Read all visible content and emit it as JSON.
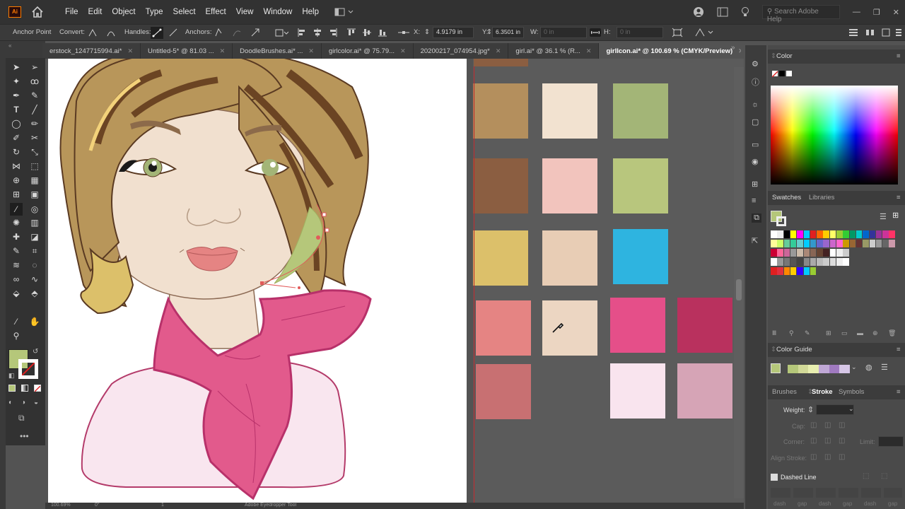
{
  "menubar": {
    "logo": "Ai",
    "items": [
      "File",
      "Edit",
      "Object",
      "Type",
      "Select",
      "Effect",
      "View",
      "Window",
      "Help"
    ],
    "search_placeholder": "Search Adobe Help"
  },
  "controlbar": {
    "anchor_point": "Anchor Point",
    "convert": "Convert:",
    "handles": "Handles:",
    "anchors": "Anchors:",
    "x_label": "X:",
    "x_value": "4.9179 in",
    "y_label": "Y:",
    "y_value": "6.3501 in",
    "w_label": "W:",
    "w_value": "0 in",
    "h_label": "H:",
    "h_value": "0 in"
  },
  "tabs": [
    {
      "label": "erstock_1247715994.ai*",
      "active": false
    },
    {
      "label": "Untitled-5* @ 81.03 ...",
      "active": false
    },
    {
      "label": "DoodleBrushes.ai* ...",
      "active": false
    },
    {
      "label": "girlcolor.ai* @ 75.79...",
      "active": false
    },
    {
      "label": "20200217_074954.jpg*",
      "active": false
    },
    {
      "label": "girl.ai* @ 36.1 % (R...",
      "active": false
    },
    {
      "label": "girlIcon.ai* @ 100.69 % (CMYK/Preview)",
      "active": true
    }
  ],
  "colors": {
    "ui_dark": "#323232",
    "fill_swatch": "#b5c77a",
    "skin": "#f1e0cf",
    "hair": "#b8965a",
    "scarf": "#e25a8c",
    "shirt": "#f9e6ef"
  },
  "palette_swatches": [
    "#b48f5d",
    "#f2e2d0",
    "#a3b577",
    "#8b5e41",
    "#f2c4bd",
    "#b8c67d",
    "#dcc06a",
    "#e8cdb5",
    "#2eb4e0",
    "#e58483",
    "#ecd6c2",
    "#e54f89",
    "#b9315e",
    "#c87072",
    "#f9e4ee",
    "#d6a4b6"
  ],
  "color_panel": {
    "title": "Color"
  },
  "swatches_panel": {
    "tab1": "Swatches",
    "tab2": "Libraries"
  },
  "color_guide": {
    "title": "Color Guide"
  },
  "stroke_panel": {
    "tabs": [
      "Brushes",
      "Stroke",
      "Symbols"
    ],
    "weight_label": "Weight:",
    "cap_label": "Cap:",
    "corner_label": "Corner:",
    "limit_label": "Limit:",
    "align_label": "Align Stroke:",
    "dashed_label": "Dashed Line",
    "dash_labels": [
      "dash",
      "gap",
      "dash",
      "gap",
      "dash",
      "gap"
    ]
  },
  "status": {
    "zoom": "100.69%",
    "rotation": "0°",
    "page": "1",
    "tool": "Adobe Eyedropper Tool"
  }
}
